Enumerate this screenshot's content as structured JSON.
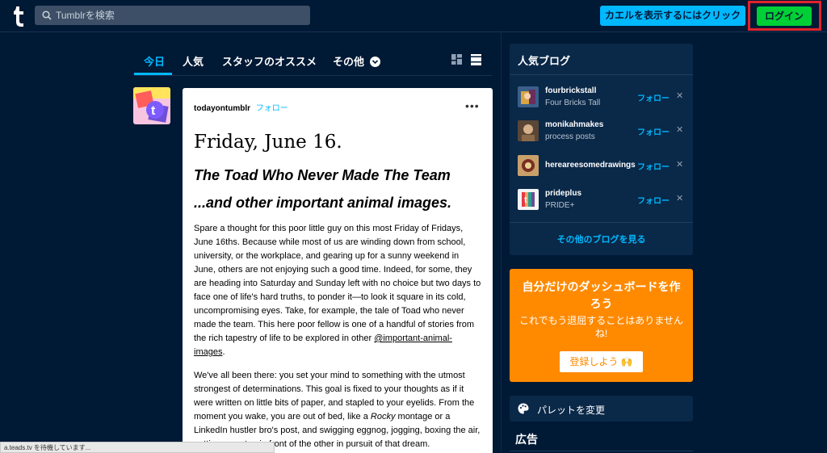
{
  "header": {
    "search_placeholder": "Tumblrを検索",
    "frog_button": "カエルを表示するにはクリック",
    "login_button": "ログイン"
  },
  "tabs": [
    {
      "label": "今日",
      "active": true
    },
    {
      "label": "人気",
      "active": false
    },
    {
      "label": "スタッフのオススメ",
      "active": false
    },
    {
      "label": "その他",
      "active": false
    }
  ],
  "post": {
    "author": "todayontumblr",
    "follow": "フォロー",
    "more": "•••",
    "date": "Friday, June 16.",
    "heading1": "The Toad Who Never Made The Team",
    "heading2": "...and other important animal images.",
    "para1": "Spare a thought for this poor little guy on this most Friday of Fridays, June 16ths. Because while most of us are winding down from school, university, or the workplace, and gearing up for a sunny weekend in June, others are not enjoying such a good time. Indeed, for some, they are heading into Saturday and Sunday left with no choice but two days to face one of life's hard truths, to ponder it—to look it square in its cold, uncompromising eyes. Take, for example, the tale of Toad who never made the team. This here poor fellow is one of a handful of stories from the rich tapestry of life to be explored in other ",
    "para1_link": "@important-animal-images",
    "para1_end": ".",
    "para2_a": "We've all been there: you set your mind to something with the utmost strongest of determinations. This goal is fixed to your thoughts as if it were written on little bits of paper, and stapled to your eyelids. From the moment you wake, you are out of bed, like a ",
    "para2_italic": "Rocky",
    "para2_b": " montage or a LinkedIn hustler bro's post, and swigging eggnog, jogging, boxing the air, putting one step in front of the other in pursuit of that dream."
  },
  "sidebar": {
    "popular_title": "人気ブログ",
    "blogs": [
      {
        "name": "fourbrickstall",
        "sub": "Four Bricks Tall",
        "follow": "フォロー",
        "dismiss": "✕"
      },
      {
        "name": "monikahmakes",
        "sub": "process posts",
        "follow": "フォロー",
        "dismiss": "✕"
      },
      {
        "name": "hereareesomedrawings",
        "sub": "",
        "follow": "フォロー",
        "dismiss": "✕"
      },
      {
        "name": "prideplus",
        "sub": "PRIDE+",
        "follow": "フォロー",
        "dismiss": "✕"
      }
    ],
    "see_more": "その他のブログを見る",
    "promo_title": "自分だけのダッシュボードを作ろう",
    "promo_sub": "これでもう退屈することはありませんね!",
    "promo_button": "登録しよう 🙌",
    "palette_label": "パレットを変更",
    "ads_title": "広告"
  },
  "status_bar": "a.teads.tv を待機しています...",
  "colors": {
    "background": "#001935",
    "accent": "#00b8ff",
    "login": "#00cf35",
    "promo": "#ff8a00"
  }
}
